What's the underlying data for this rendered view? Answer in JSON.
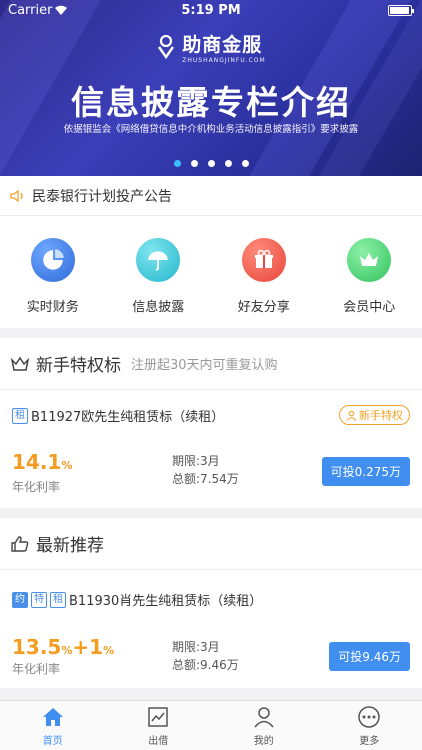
{
  "status_bar": {
    "carrier": "Carrier",
    "time": "5:19 PM"
  },
  "banner": {
    "brand": "助商金服",
    "brand_sub": "ZHUSHANGJINFU.COM",
    "headline": "信息披露专栏介绍",
    "caption": "依据银监会《网络借贷信息中介机构业务活动信息披露指引》要求披露",
    "page_count": 5,
    "active_page": 1
  },
  "notice": {
    "text": "民泰银行计划投产公告"
  },
  "quicknav": [
    {
      "label": "实时财务",
      "icon": "pie-chart-icon",
      "color": "#3d7fe6"
    },
    {
      "label": "信息披露",
      "icon": "umbrella-icon",
      "color": "#2fc2d6"
    },
    {
      "label": "好友分享",
      "icon": "gift-icon",
      "color": "#f05a4a"
    },
    {
      "label": "会员中心",
      "icon": "crown-icon",
      "color": "#3fcf6a"
    }
  ],
  "novice_section": {
    "title": "新手特权标",
    "hint": "注册起30天内可重复认购",
    "product": {
      "tags": [
        "租"
      ],
      "name": "B11927欧先生纯租赁标（续租）",
      "badge": "新手特权",
      "rate": "14.1",
      "rate_unit": "%",
      "rate_label": "年化利率",
      "term": "期限:3月",
      "total": "总额:7.54万",
      "button": "可投0.275万"
    }
  },
  "latest_section": {
    "title": "最新推荐",
    "product": {
      "tags": [
        "约",
        "特",
        "租"
      ],
      "name": "B11930肖先生纯租赁标（续租）",
      "rate": "13.5",
      "rate_unit": "%",
      "rate_extra": "+1",
      "rate_extra_unit": "%",
      "rate_label": "年化利率",
      "term": "期限:3月",
      "total": "总额:9.46万",
      "button": "可投9.46万"
    }
  },
  "tabbar": [
    {
      "label": "首页",
      "icon": "home-icon",
      "active": true
    },
    {
      "label": "出借",
      "icon": "chart-icon",
      "active": false
    },
    {
      "label": "我的",
      "icon": "user-icon",
      "active": false
    },
    {
      "label": "更多",
      "icon": "more-icon",
      "active": false
    }
  ],
  "colors": {
    "accent": "#3f8ef0",
    "rate": "#f39c1f",
    "banner": "#2e2a8a"
  }
}
